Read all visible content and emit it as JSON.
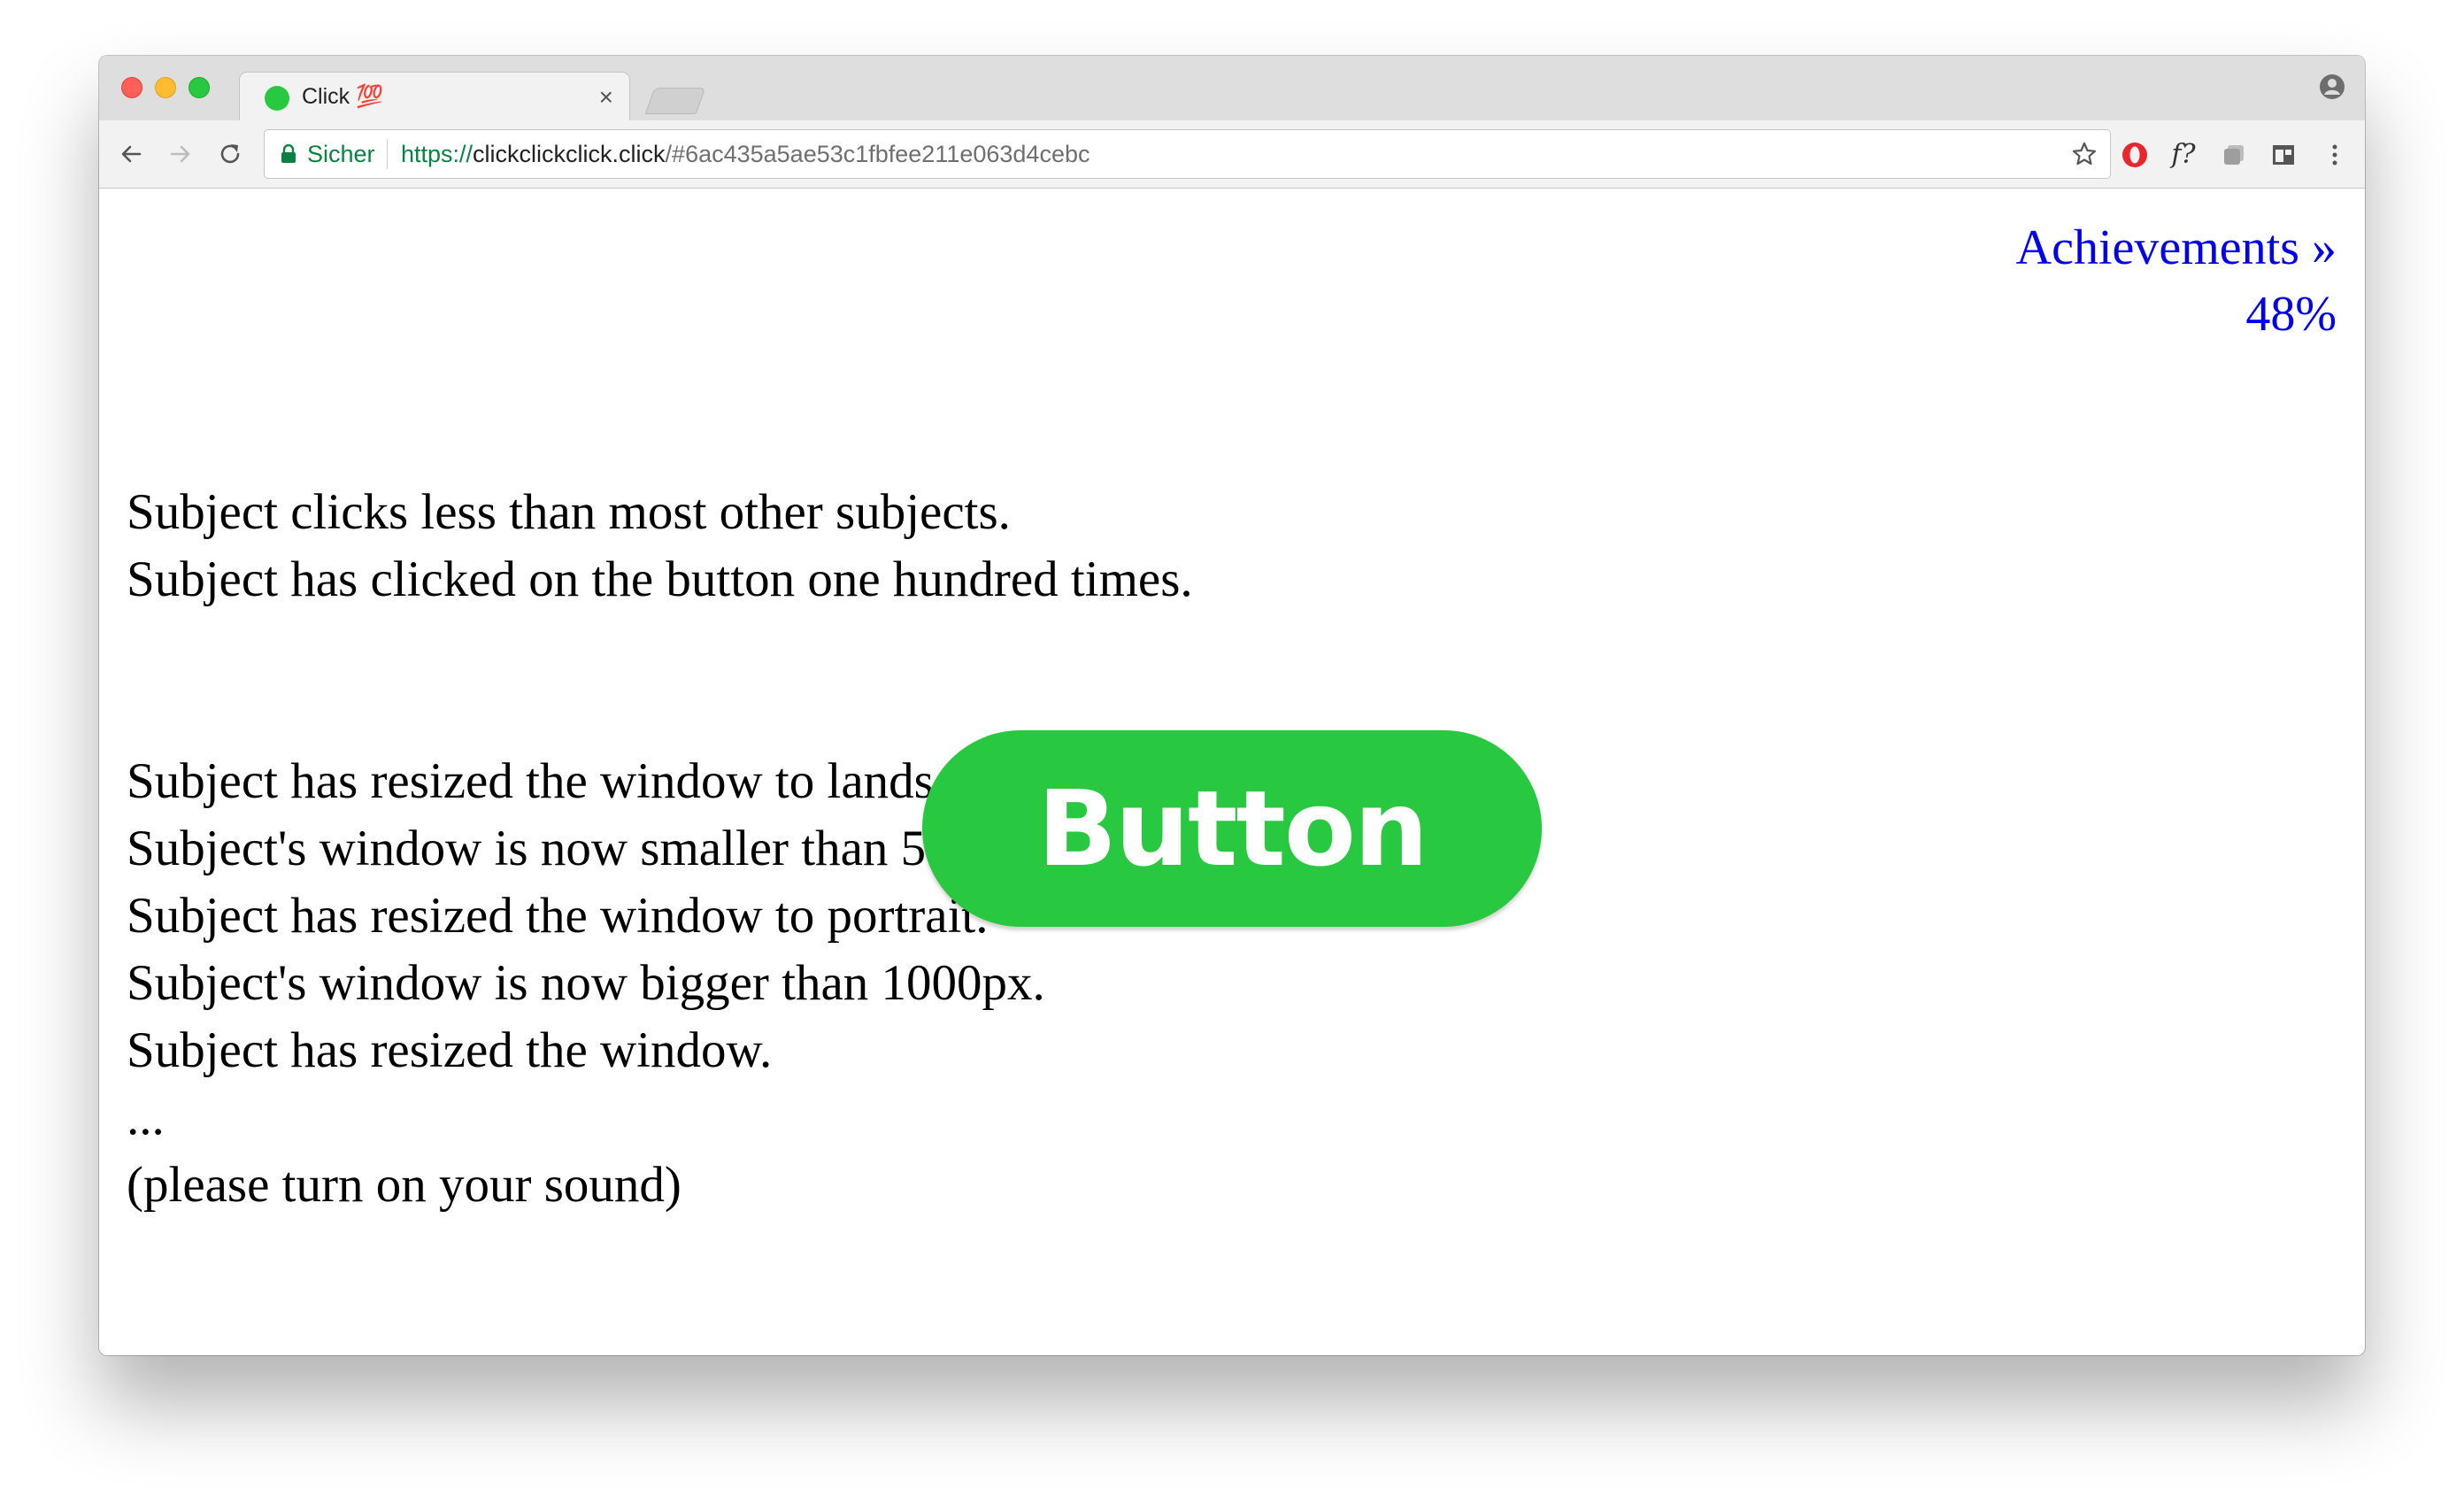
{
  "browser": {
    "tab": {
      "title": "Click 💯",
      "close_glyph": "×",
      "favicon_color": "#28c840"
    },
    "toolbar": {
      "secure_label": "Sicher",
      "url_scheme": "https://",
      "url_host": "clickclickclick.click",
      "url_rest": "/#6ac435a5ae53c1fbfee211e063d4cebc",
      "font_ext_label": "f?"
    },
    "icons": [
      "back-icon",
      "forward-icon",
      "reload-icon",
      "lock-icon",
      "star-icon",
      "opera-icon",
      "font-icon",
      "ghost-icon",
      "dark-mode-icon",
      "menu-icon",
      "profile-icon"
    ]
  },
  "page": {
    "achievements_link": "Achievements »",
    "achievements_percent": "48%",
    "log_group1": [
      "Subject clicks less than most other subjects.",
      "Subject has clicked on the button one hundred times."
    ],
    "log_group2": [
      "Subject has resized the window to landscape.",
      "Subject's window is now smaller than 500px.",
      "Subject has resized the window to portrait.",
      "Subject's window is now bigger than 1000px.",
      "Subject has resized the window.",
      "...",
      "(please turn on your sound)"
    ],
    "button_label": "Button"
  },
  "colors": {
    "button": "#28c840",
    "link": "#0000ee",
    "secure": "#0b8043"
  }
}
